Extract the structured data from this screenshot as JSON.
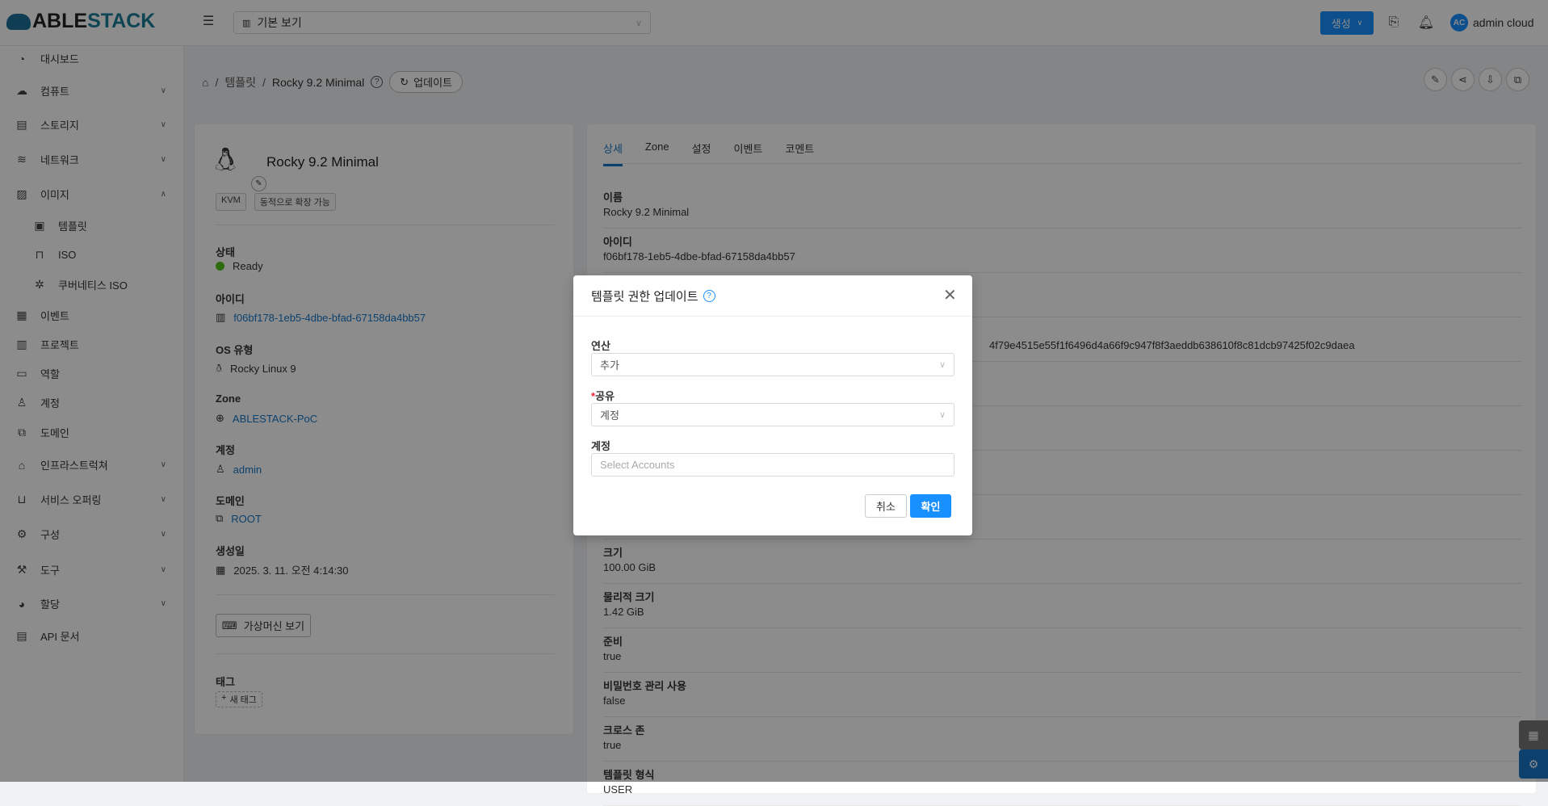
{
  "header": {
    "logo_text": "ABLESTACK",
    "view_select": "기본 보기",
    "create_label": "생성",
    "user_initials": "AC",
    "user_name": "admin cloud"
  },
  "sidebar": {
    "items": [
      {
        "label": "대시보드"
      },
      {
        "label": "컴퓨트"
      },
      {
        "label": "스토리지"
      },
      {
        "label": "네트워크"
      },
      {
        "label": "이미지"
      },
      {
        "label": "템플릿"
      },
      {
        "label": "ISO"
      },
      {
        "label": "쿠버네티스 ISO"
      },
      {
        "label": "이벤트"
      },
      {
        "label": "프로젝트"
      },
      {
        "label": "역할"
      },
      {
        "label": "계정"
      },
      {
        "label": "도메인"
      },
      {
        "label": "인프라스트럭쳐"
      },
      {
        "label": "서비스 오퍼링"
      },
      {
        "label": "구성"
      },
      {
        "label": "도구"
      },
      {
        "label": "할당"
      },
      {
        "label": "API 문서"
      }
    ]
  },
  "breadcrumb": {
    "parent": "템플릿",
    "current": "Rocky 9.2 Minimal",
    "update_label": "업데이트"
  },
  "summary": {
    "title": "Rocky 9.2 Minimal",
    "tags": [
      "KVM",
      "동적으로 확장 가능"
    ],
    "status_label": "상태",
    "status": "Ready",
    "id_label": "아이디",
    "id": "f06bf178-1eb5-4dbe-bfad-67158da4bb57",
    "os_label": "OS 유형",
    "os": "Rocky Linux 9",
    "zone_label": "Zone",
    "zone": "ABLESTACK-PoC",
    "account_label": "계정",
    "account": "admin",
    "domain_label": "도메인",
    "domain": "ROOT",
    "created_label": "생성일",
    "created": "2025. 3. 11. 오전 4:14:30",
    "view_vm_label": "가상머신 보기",
    "tags_label": "태그",
    "new_tag_label": "새 태그"
  },
  "detail": {
    "tabs": [
      "상세",
      "Zone",
      "설정",
      "이벤트",
      "코멘트"
    ],
    "rows": [
      {
        "label": "이름",
        "value": "Rocky 9.2 Minimal"
      },
      {
        "label": "아이디",
        "value": "f06bf178-1eb5-4dbe-bfad-67158da4bb57"
      },
      {
        "label": "",
        "value": ""
      },
      {
        "label": "",
        "value": "4f79e4515e55f1f6496d4a66f9c947f8f3aeddb638610f8c81dcb97425f02c9daea"
      },
      {
        "label": "",
        "value": ""
      },
      {
        "label": "",
        "value": ""
      },
      {
        "label": "",
        "value": ""
      },
      {
        "label": "",
        "value": ""
      },
      {
        "label": "크기",
        "value": "100.00 GiB"
      },
      {
        "label": "물리적 크기",
        "value": "1.42 GiB"
      },
      {
        "label": "준비",
        "value": "true"
      },
      {
        "label": "비밀번호 관리 사용",
        "value": "false"
      },
      {
        "label": "크로스 존",
        "value": "true"
      },
      {
        "label": "템플릿 형식",
        "value": "USER"
      }
    ]
  },
  "modal": {
    "title": "템플릿 권한 업데이트",
    "op_label": "연산",
    "op_value": "추가",
    "share_label": "공유",
    "share_value": "계정",
    "accounts_label": "계정",
    "accounts_placeholder": "Select Accounts",
    "cancel_label": "취소",
    "ok_label": "확인"
  },
  "colors": {
    "primary": "#1890ff",
    "link": "#1677c8",
    "ready": "#52c41a"
  }
}
